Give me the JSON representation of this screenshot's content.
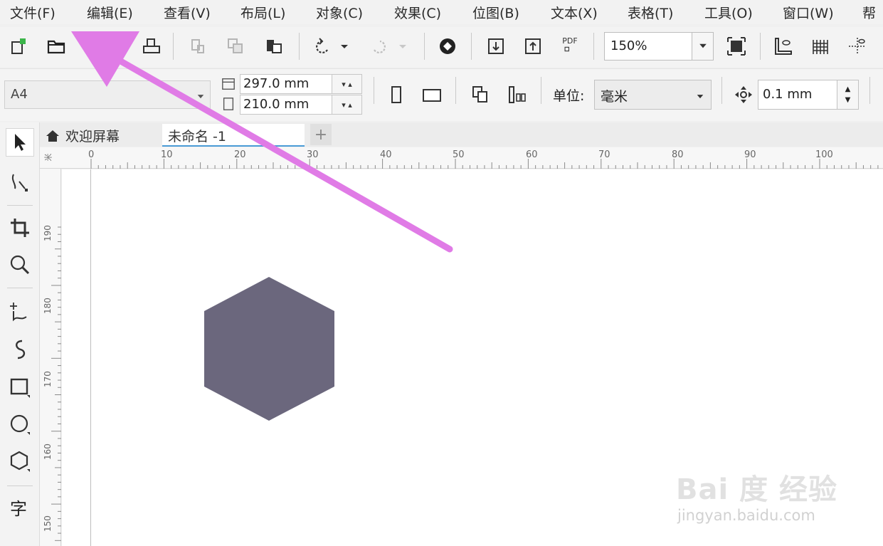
{
  "menu": [
    "文件(F)",
    "编辑(E)",
    "查看(V)",
    "布局(L)",
    "对象(C)",
    "效果(C)",
    "位图(B)",
    "文本(X)",
    "表格(T)",
    "工具(O)",
    "窗口(W)",
    "帮"
  ],
  "toolbar": {
    "zoom_value": "150%",
    "pdf_label": "PDF"
  },
  "property_bar": {
    "page_size": "A4",
    "width": "297.0 mm",
    "height": "210.0 mm",
    "units_label": "单位:",
    "units_value": "毫米",
    "nudge_value": "0.1 mm"
  },
  "tabs": {
    "welcome": "欢迎屏幕",
    "document": "未命名 -1"
  },
  "rulers": {
    "corner_unit": "米",
    "horizontal_ticks": [
      "0",
      "10",
      "20",
      "30",
      "40",
      "50",
      "60",
      "70",
      "80",
      "90",
      "100"
    ],
    "vertical_ticks": [
      "190",
      "180",
      "170",
      "160",
      "150"
    ]
  },
  "canvas": {
    "shape_color": "#6b677d"
  },
  "annotation": {
    "arrow_color": "#e07be6"
  },
  "watermark": {
    "logo_text": "Bai 度 经验",
    "url": "jingyan.baidu.com"
  }
}
